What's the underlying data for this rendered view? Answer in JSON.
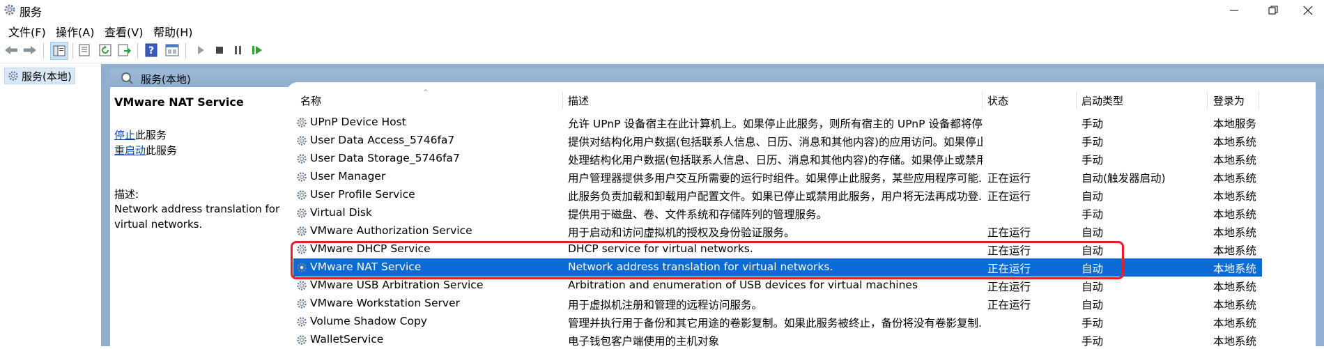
{
  "window": {
    "title": "服务"
  },
  "menu": [
    "文件(F)",
    "操作(A)",
    "查看(V)",
    "帮助(H)"
  ],
  "tree": {
    "node_label": "服务(本地)"
  },
  "header": {
    "label": "服务(本地)"
  },
  "detail": {
    "service_name": "VMware NAT Service",
    "stop_link": "停止",
    "stop_suffix": "此服务",
    "restart_link": "重启动",
    "restart_suffix": "此服务",
    "desc_label": "描述:",
    "desc_text": "Network address translation for virtual networks."
  },
  "columns": {
    "name": "名称",
    "description": "描述",
    "status": "状态",
    "startup": "启动类型",
    "logon": "登录为"
  },
  "rows": [
    {
      "name": "UPnP Device Host",
      "description": "允许 UPnP 设备宿主在此计算机上。如果停止此服务，则所有宿主的 UPnP 设备都将停...",
      "status": "",
      "startup": "手动",
      "logon": "本地服务"
    },
    {
      "name": "User Data Access_5746fa7",
      "description": "提供对结构化用户数据(包括联系人信息、日历、消息和其他内容)的应用访问。如果停止...",
      "status": "",
      "startup": "手动",
      "logon": "本地系统"
    },
    {
      "name": "User Data Storage_5746fa7",
      "description": "处理结构化用户数据(包括联系人信息、日历、消息和其他内容)的存储。如果停止或禁用...",
      "status": "",
      "startup": "手动",
      "logon": "本地系统"
    },
    {
      "name": "User Manager",
      "description": "用户管理器提供多用户交互所需要的运行时组件。如果停止此服务，某些应用程序可能...",
      "status": "正在运行",
      "startup": "自动(触发器启动)",
      "logon": "本地系统"
    },
    {
      "name": "User Profile Service",
      "description": "此服务负责加载和卸载用户配置文件。如果已停止或禁用此服务，用户将无法再成功登...",
      "status": "正在运行",
      "startup": "自动",
      "logon": "本地系统"
    },
    {
      "name": "Virtual Disk",
      "description": "提供用于磁盘、卷、文件系统和存储阵列的管理服务。",
      "status": "",
      "startup": "手动",
      "logon": "本地系统"
    },
    {
      "name": "VMware Authorization Service",
      "description": "用于启动和访问虚拟机的授权及身份验证服务。",
      "status": "正在运行",
      "startup": "自动",
      "logon": "本地系统"
    },
    {
      "name": "VMware DHCP Service",
      "description": "DHCP service for virtual networks.",
      "status": "正在运行",
      "startup": "自动",
      "logon": "本地系统"
    },
    {
      "name": "VMware NAT Service",
      "description": "Network address translation for virtual networks.",
      "status": "正在运行",
      "startup": "自动",
      "logon": "本地系统"
    },
    {
      "name": "VMware USB Arbitration Service",
      "description": "Arbitration and enumeration of USB devices for virtual machines",
      "status": "正在运行",
      "startup": "自动",
      "logon": "本地系统"
    },
    {
      "name": "VMware Workstation Server",
      "description": "用于虚拟机注册和管理的远程访问服务。",
      "status": "正在运行",
      "startup": "自动",
      "logon": "本地系统"
    },
    {
      "name": "Volume Shadow Copy",
      "description": "管理并执行用于备份和其它用途的卷影复制。如果此服务被终止，备份将没有卷影复制...",
      "status": "",
      "startup": "手动",
      "logon": "本地系统"
    },
    {
      "name": "WalletService",
      "description": "电子钱包客户端使用的主机对象",
      "status": "",
      "startup": "手动",
      "logon": "本地系统"
    }
  ],
  "colors": {
    "selection": "#0a6bd4",
    "highlight_box": "#e81e25",
    "header_band": "#8fb0d0"
  }
}
